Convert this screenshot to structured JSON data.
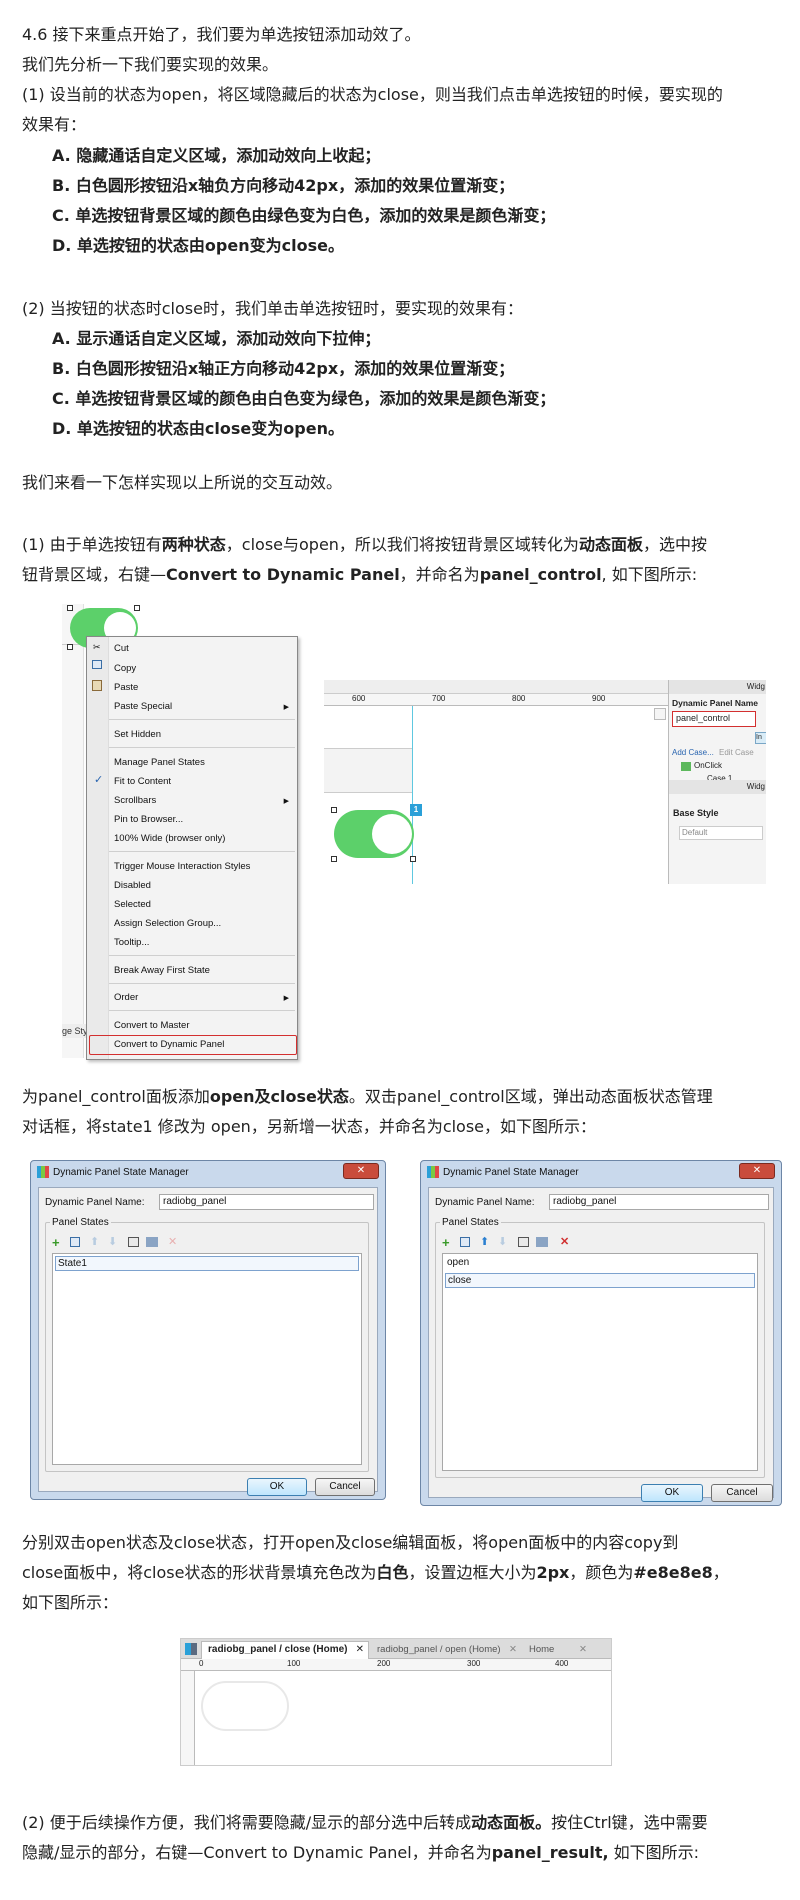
{
  "intro": {
    "l1": "4.6 接下来重点开始了，我们要为单选按钮添加动效了。",
    "l2": "我们先分析一下我们要实现的效果。",
    "l3": "(1) 设当前的状态为open，将区域隐藏后的状态为close，则当我们点击单选按钮的时候，要实现的",
    "l4": "效果有：",
    "a": "A. 隐藏通话自定义区域，添加动效向上收起；",
    "b": "B. 白色圆形按钮沿x轴负方向移动42px，添加的效果位置渐变；",
    "c": "C. 单选按钮背景区域的颜色由绿色变为白色，添加的效果是颜色渐变；",
    "d": "D. 单选按钮的状态由open变为close。"
  },
  "part2": {
    "l1": "(2) 当按钮的状态时close时，我们单击单选按钮时，要实现的效果有：",
    "a": "A. 显示通话自定义区域，添加动效向下拉伸；",
    "b": "B. 白色圆形按钮沿x轴正方向移动42px，添加的效果位置渐变；",
    "c": "C. 单选按钮背景区域的颜色由白色变为绿色，添加的效果是颜色渐变；",
    "d": "D. 单选按钮的状态由close变为open。"
  },
  "see": "我们来看一下怎样实现以上所说的交互动效。",
  "step1": {
    "t1": "(1) 由于单选按钮有",
    "b1": "两种状态",
    "t2": "，close与open，所以我们将按钮背景区域转化为",
    "b2": "动态面板",
    "t3": "，选中按",
    "l2a": "钮背景区域，右键—",
    "l2b": "Convert to Dynamic Panel",
    "l2c": "，并命名为",
    "l2d": "panel_control",
    "l2e": ", 如下图所示:"
  },
  "context_menu": {
    "items": [
      "Cut",
      "Copy",
      "Paste",
      "Paste Special",
      "Set Hidden",
      "Manage Panel States",
      "Fit to Content",
      "Scrollbars",
      "Pin to Browser...",
      "100% Wide (browser only)",
      "Trigger Mouse Interaction Styles",
      "Disabled",
      "Selected",
      "Assign Selection Group...",
      "Tooltip...",
      "Break Away First State",
      "Order",
      "Convert to Master",
      "Convert to Dynamic Panel"
    ],
    "edge_label": "ge Sty"
  },
  "axure_panel": {
    "ruler": [
      "600",
      "700",
      "800",
      "900"
    ],
    "widget_tab": "Widg",
    "dp_name_label": "Dynamic Panel Name",
    "dp_name_value": "panel_control",
    "in_btn": "In",
    "add_case": "Add Case...",
    "edit_case": "Edit Case",
    "onclick": "OnClick",
    "case1": "Case 1",
    "widget_tab2": "Widg",
    "base_style": "Base Style",
    "default": "Default",
    "badge": "1"
  },
  "step1b": {
    "t1": "为panel_control面板添加",
    "b1": "open及close状态",
    "t2": "。双击panel_control区域，弹出动态面板状态管理",
    "l2": "对话框，将state1 修改为 open，另新增一状态，并命名为close，如下图所示："
  },
  "dialog1": {
    "title": "Dynamic Panel State Manager",
    "close": "✕",
    "name_label": "Dynamic Panel Name:",
    "name_value": "radiobg_panel",
    "group": "Panel States",
    "states": [
      "State1"
    ],
    "ok": "OK",
    "cancel": "Cancel"
  },
  "dialog2": {
    "title": "Dynamic Panel State Manager",
    "close": "✕",
    "name_label": "Dynamic Panel Name:",
    "name_value": "radiobg_panel",
    "group": "Panel States",
    "states": [
      "open",
      "close"
    ],
    "ok": "OK",
    "cancel": "Cancel"
  },
  "step1c": {
    "l1": "分别双击open状态及close状态，打开open及close编辑面板，将open面板中的内容copy到",
    "l2a": "close面板中，将close状态的形状背景填充色改为",
    "l2b": "白色",
    "l2c": "，设置边框大小为",
    "l2d": "2px",
    "l2e": "，颜色为",
    "l2f": "#e8e8e8",
    "l2g": "，",
    "l3": "如下图所示："
  },
  "editor": {
    "tabs": [
      "radiobg_panel / close (Home)",
      "radiobg_panel / open (Home)",
      "Home"
    ],
    "ruler": [
      "0",
      "100",
      "200",
      "300",
      "400"
    ]
  },
  "step2": {
    "t1": "(2) 便于后续操作方便，我们将需要隐藏/显示的部分选中后转成",
    "b1": "动态面板。",
    "t2": "按住Ctrl键，选中需要",
    "l2a": "隐藏/显示的部分，右键—Convert to Dynamic Panel，并命名为",
    "l2b": "panel_result,",
    "l2c": " 如下图所示:"
  },
  "colors": {
    "green": "#5cd06a",
    "highlight": "#d32f2f",
    "accent": "#2aa0d8"
  }
}
